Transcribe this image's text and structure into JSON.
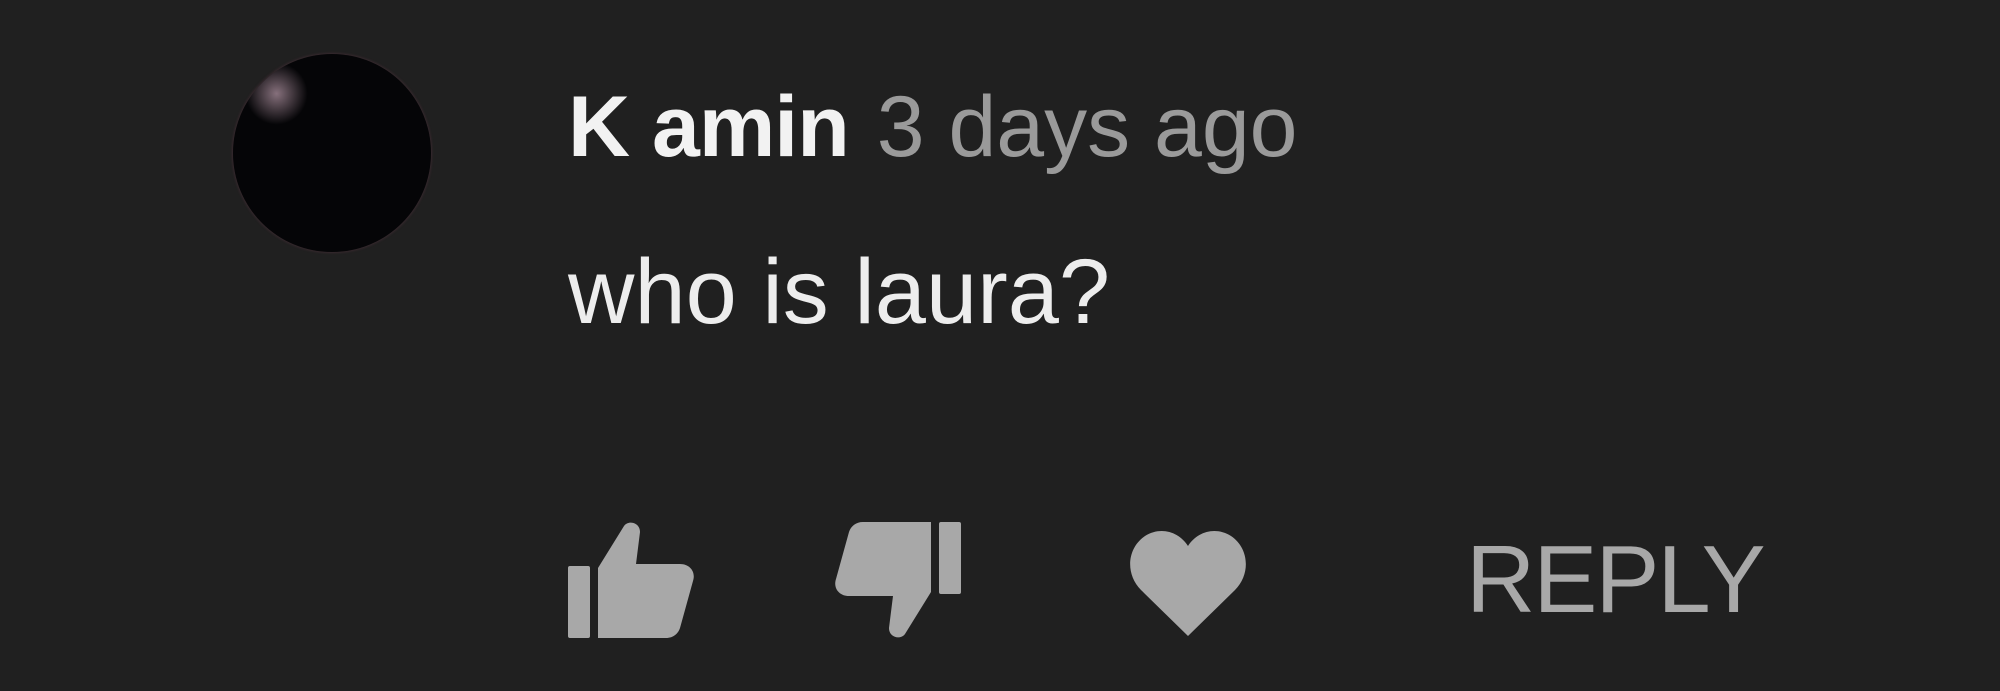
{
  "comment": {
    "author": "K amin",
    "timestamp": "3 days ago",
    "text": "who is laura?"
  },
  "actions": {
    "like_icon": "thumbs-up-icon",
    "dislike_icon": "thumbs-down-icon",
    "heart_icon": "heart-icon",
    "reply_label": "REPLY"
  },
  "colors": {
    "background": "#202020",
    "author": "#f2f2f2",
    "timestamp": "#9a9a9a",
    "text": "#ededed",
    "icons": "#a8a8a8",
    "avatar_ring": "#8e3f60"
  }
}
